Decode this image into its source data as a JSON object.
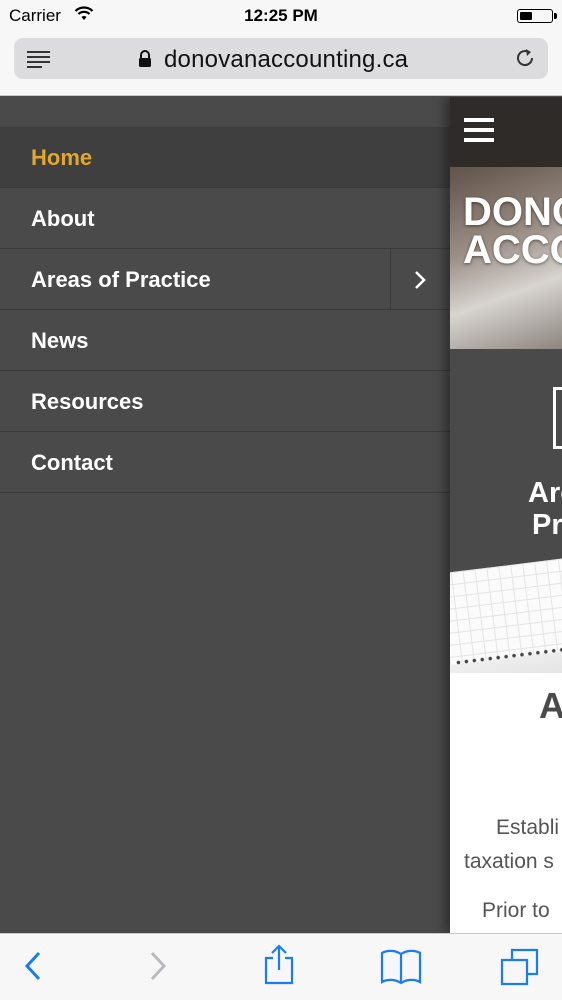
{
  "status_bar": {
    "carrier": "Carrier",
    "time": "12:25 PM",
    "battery_level": 0.35,
    "icons": [
      "wifi-icon",
      "battery-icon"
    ]
  },
  "browser": {
    "url": "donovanaccounting.ca",
    "icons": [
      "reader-mode-icon",
      "lock-icon",
      "reload-icon"
    ]
  },
  "menu": {
    "items": [
      {
        "label": "Home",
        "active": true
      },
      {
        "label": "About"
      },
      {
        "label": "Areas of Practice",
        "has_submenu": true
      },
      {
        "label": "News"
      },
      {
        "label": "Resources"
      },
      {
        "label": "Contact"
      }
    ],
    "active_color": "#e3a72f",
    "background_color": "#4a4a4a"
  },
  "content": {
    "hero_title_line1": "DONO",
    "hero_title_line2": "ACCO",
    "practice_title_line1": "Are",
    "practice_title_line2": "Pr",
    "about_heading": "A",
    "about_line1": "Establi",
    "about_line2": "taxation s",
    "about_line3": "Prior to"
  },
  "toolbar": {
    "icons": [
      "back-icon",
      "forward-icon",
      "share-icon",
      "bookmarks-icon",
      "tabs-icon"
    ],
    "accent_color": "#1a7cf5"
  }
}
